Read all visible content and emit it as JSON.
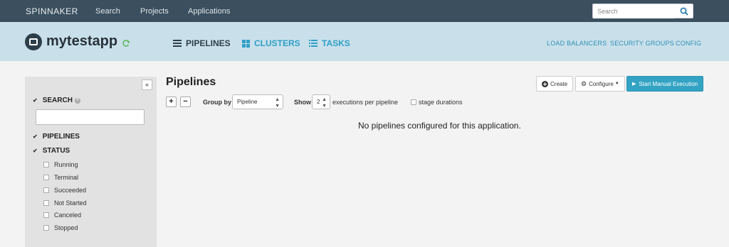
{
  "topnav": {
    "brand": "SPINNAKER",
    "links": [
      "Search",
      "Projects",
      "Applications"
    ],
    "search_placeholder": "Search"
  },
  "app": {
    "name": "mytestapp",
    "tabs": [
      "PIPELINES",
      "CLUSTERS",
      "TASKS"
    ],
    "active_tab": "PIPELINES",
    "right_links": [
      "LOAD BALANCERS",
      "SECURITY GROUPS",
      "CONFIG"
    ]
  },
  "sidebar": {
    "collapse_label": "«",
    "search_label": "SEARCH",
    "help_label": "?",
    "pipelines_label": "PIPELINES",
    "status_label": "STATUS",
    "status_items": [
      "Running",
      "Terminal",
      "Succeeded",
      "Not Started",
      "Canceled",
      "Stopped"
    ]
  },
  "main": {
    "title": "Pipelines",
    "create_label": "Create",
    "configure_label": "Configure",
    "start_label": "Start Manual Execution",
    "expand_label": "+",
    "collapse_label": "−",
    "group_by_label": "Group by",
    "group_by_value": "Pipeline",
    "show_label": "Show",
    "show_value": "2",
    "executions_label": "executions per pipeline",
    "stage_durations_label": "stage durations",
    "empty_message": "No pipelines configured for this application."
  },
  "colors": {
    "topnav_bg": "#3b4f5e",
    "header_bg": "#c9e0ea",
    "accent": "#2f9fc7",
    "primary_button": "#33a3c4"
  }
}
